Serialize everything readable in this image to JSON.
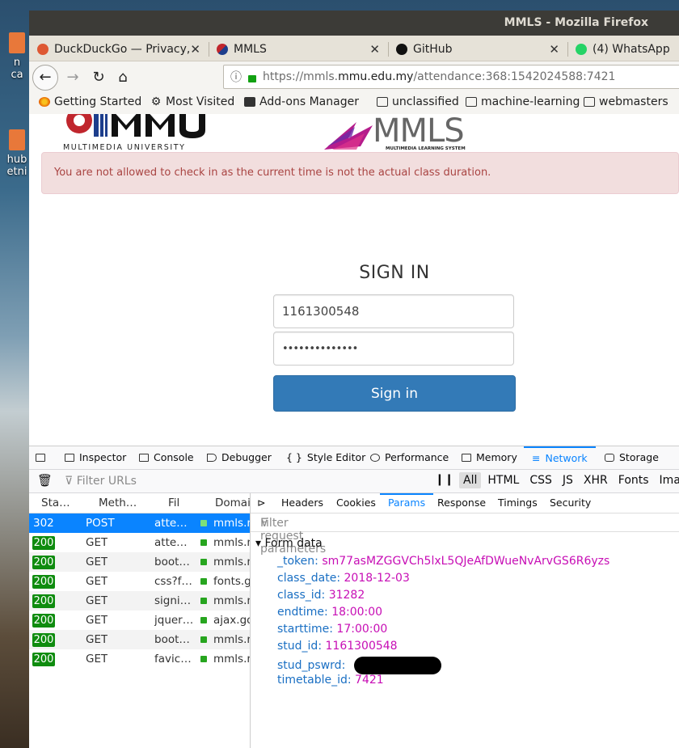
{
  "desktop": {
    "icons": [
      {
        "label_line1": "n",
        "label_line2": "ca"
      },
      {
        "label_line1": "hub",
        "label_line2": "etni"
      }
    ]
  },
  "window": {
    "title": "MMLS - Mozilla Firefox"
  },
  "tabs": [
    {
      "label": "DuckDuckGo — Privacy,",
      "icon": "duckduckgo-icon",
      "color": "#de5833"
    },
    {
      "label": "MMLS",
      "icon": "mmls-icon",
      "color": "#1d3e8c"
    },
    {
      "label": "GitHub",
      "icon": "github-icon",
      "color": "#111111"
    },
    {
      "label": "(4) WhatsApp",
      "icon": "whatsapp-icon",
      "color": "#25d366"
    }
  ],
  "urlbar": {
    "scheme": "https://mmls.",
    "host": "mmu.edu.my",
    "path": "/attendance:368:1542024588:7421"
  },
  "bookmarks": [
    {
      "label": "Getting Started",
      "icon": "firefox-icon"
    },
    {
      "label": "Most Visited",
      "icon": "gear-icon"
    },
    {
      "label": "Add-ons Manager",
      "icon": "puzzle-icon"
    },
    {
      "label": "unclassified",
      "icon": "folder-icon"
    },
    {
      "label": "machine-learning",
      "icon": "folder-icon"
    },
    {
      "label": "webmasters",
      "icon": "folder-icon"
    }
  ],
  "page": {
    "mmu_logo_text": "MULTIMEDIA UNIVERSITY",
    "mmls_logo_sub": "MULTIMEDIA LEARNING SYSTEM",
    "alert": "You are not allowed to check in as the current time is not the actual class duration.",
    "signin_title": "SIGN IN",
    "username_value": "1161300548",
    "password_value": "••••••••••••••",
    "signin_button": "Sign in"
  },
  "devtools": {
    "tabs": [
      "Inspector",
      "Console",
      "Debugger",
      "Style Editor",
      "Performance",
      "Memory",
      "Network",
      "Storage"
    ],
    "active_tab": "Network",
    "filter_urls_placeholder": "Filter URLs",
    "type_filters": [
      "All",
      "HTML",
      "CSS",
      "JS",
      "XHR",
      "Fonts",
      "Ima"
    ],
    "columns": [
      "Sta…",
      "Meth…",
      "Fil",
      "Domai"
    ],
    "requests": [
      {
        "status": "302",
        "method": "POST",
        "file": "atte…",
        "domain": "mmls.m"
      },
      {
        "status": "200",
        "method": "GET",
        "file": "atte…",
        "domain": "mmls.m"
      },
      {
        "status": "200",
        "method": "GET",
        "file": "boot…",
        "domain": "mmls.m"
      },
      {
        "status": "200",
        "method": "GET",
        "file": "css?f…",
        "domain": "fonts.g"
      },
      {
        "status": "200",
        "method": "GET",
        "file": "signi…",
        "domain": "mmls.m"
      },
      {
        "status": "200",
        "method": "GET",
        "file": "jquer…",
        "domain": "ajax.go"
      },
      {
        "status": "200",
        "method": "GET",
        "file": "boot…",
        "domain": "mmls.m"
      },
      {
        "status": "200",
        "method": "GET",
        "file": "favic…",
        "domain": "mmls.m"
      }
    ],
    "detail_tabs": [
      "Headers",
      "Cookies",
      "Params",
      "Response",
      "Timings",
      "Security"
    ],
    "active_detail_tab": "Params",
    "filter_params_placeholder": "Filter request parameters",
    "section_title": "Form data",
    "params": [
      {
        "key": "_token:",
        "value": "sm77asMZGGVCh5lxL5QJeAfDWueNvArvGS6R6yzs"
      },
      {
        "key": "class_date:",
        "value": "2018-12-03"
      },
      {
        "key": "class_id:",
        "value": "31282"
      },
      {
        "key": "endtime:",
        "value": "18:00:00"
      },
      {
        "key": "starttime:",
        "value": "17:00:00"
      },
      {
        "key": "stud_id:",
        "value": "1161300548"
      },
      {
        "key": "stud_pswrd:",
        "value": ""
      },
      {
        "key": "timetable_id:",
        "value": "7421"
      }
    ]
  }
}
